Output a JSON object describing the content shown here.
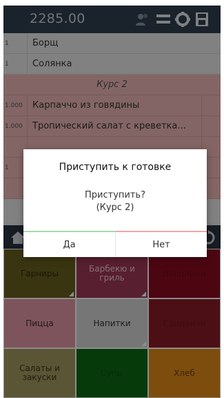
{
  "header": {
    "total": "2285.00",
    "icons": [
      "users-icon",
      "menu-icon",
      "gear-icon",
      "save-icon"
    ]
  },
  "order": {
    "rows": [
      {
        "qty": "1",
        "name": "Борщ"
      },
      {
        "qty": "1",
        "name": "Солянка"
      }
    ],
    "course_label": "Курс 2",
    "course_rows": [
      {
        "qty": "1.000",
        "name": "Карпаччо из говядины"
      },
      {
        "qty": "1.000",
        "name": "Тропический салат с креветка..."
      },
      {
        "qty": "",
        "name": ""
      },
      {
        "qty": "1",
        "name": ""
      },
      {
        "qty": "",
        "name": ""
      }
    ]
  },
  "categories": [
    {
      "label": "Гарниры",
      "color": "#6b6220",
      "text_color": "#2b2a10"
    },
    {
      "label": "Барбекю и гриль",
      "color": "#a13a58",
      "text_color": "#f2c8d4"
    },
    {
      "label": "Шашлыки",
      "color": "#8b0c22",
      "text_color": "#6a0a1a"
    },
    {
      "label": "Пицца",
      "color": "#e69aa8",
      "text_color": "#3a2a2e"
    },
    {
      "label": "Напитки",
      "color": "#d8d8d8",
      "text_color": "#333333"
    },
    {
      "label": "Сандвичи",
      "color": "#8a1c27",
      "text_color": "#6a1620"
    },
    {
      "label": "Салаты и закуски",
      "color": "#a39b61",
      "text_color": "#3a3720"
    },
    {
      "label": "Супы",
      "color": "#0c6a15",
      "text_color": "#0a5212"
    },
    {
      "label": "Хлеб",
      "color": "#e48d1a",
      "text_color": "#6a4010"
    }
  ],
  "dialog": {
    "title": "Приступить к готовке",
    "message_line1": "Приступить?",
    "message_line2": "(Курс 2)",
    "yes_label": "Да",
    "no_label": "Нет"
  }
}
